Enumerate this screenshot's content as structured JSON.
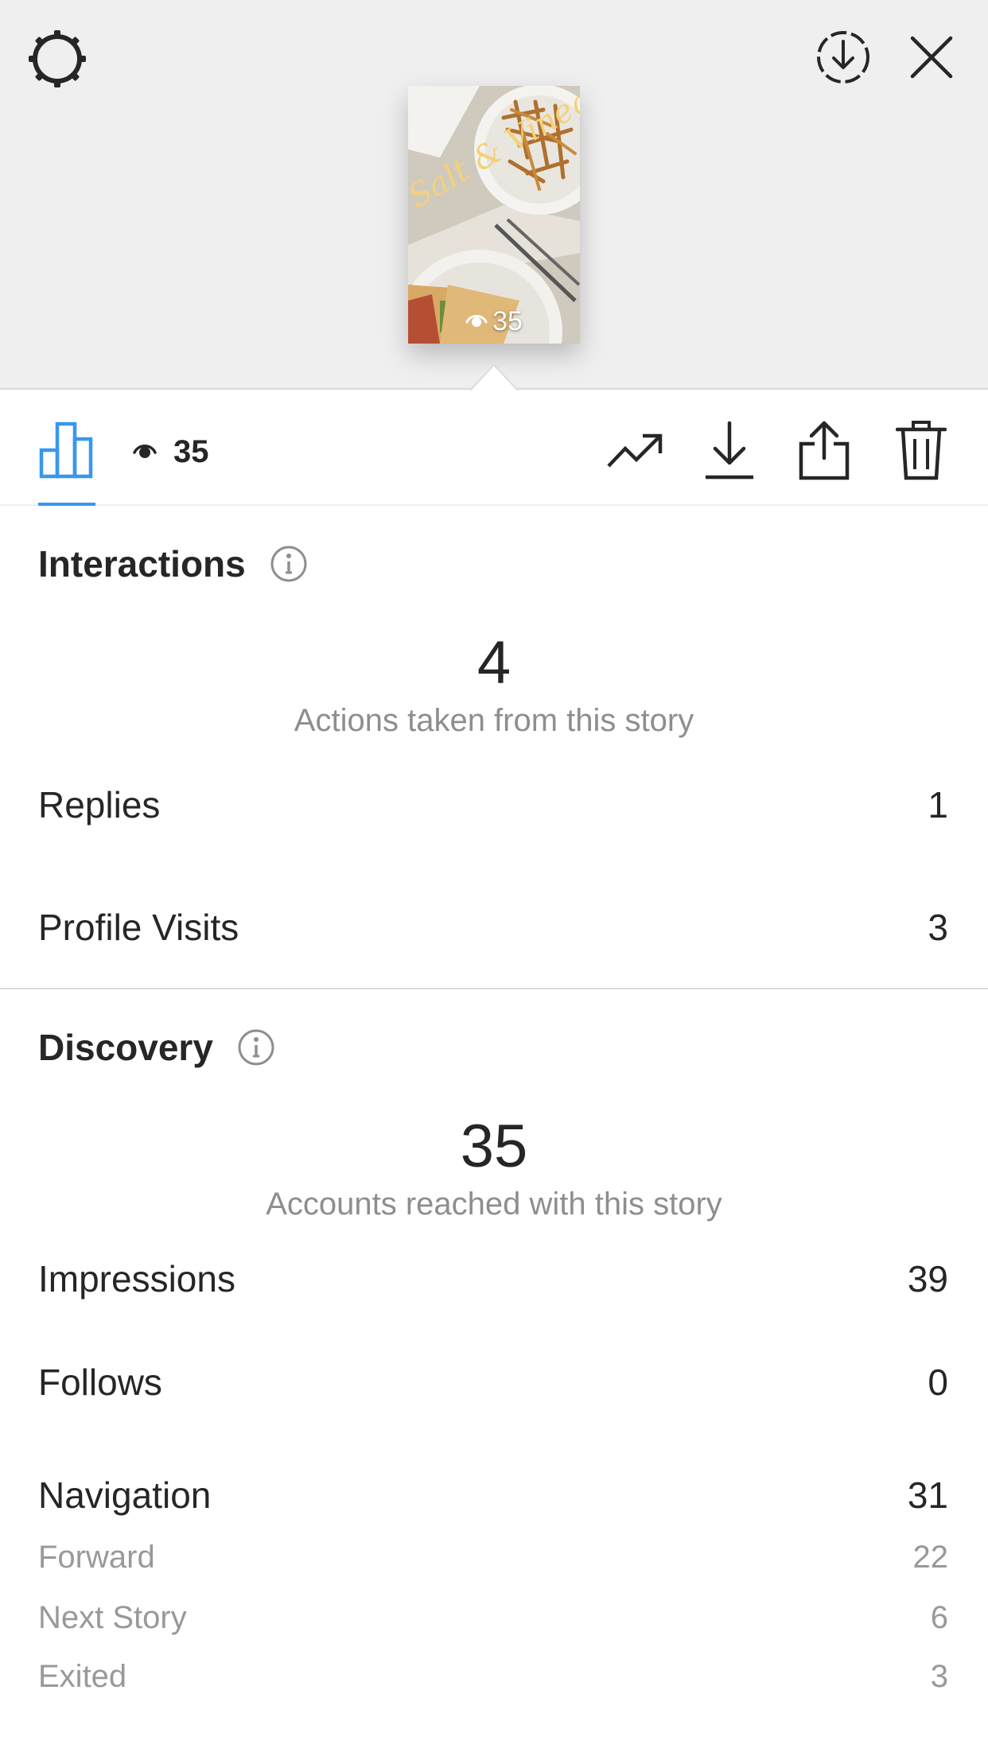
{
  "story": {
    "overlay_text": "Salt & Vinegar",
    "view_count": "35"
  },
  "toolbar": {
    "viewers_count": "35"
  },
  "interactions": {
    "title": "Interactions",
    "total": "4",
    "caption": "Actions taken from this story",
    "rows": [
      {
        "label": "Replies",
        "value": "1"
      },
      {
        "label": "Profile Visits",
        "value": "3"
      }
    ]
  },
  "discovery": {
    "title": "Discovery",
    "total": "35",
    "caption": "Accounts reached with this story",
    "rows": [
      {
        "label": "Impressions",
        "value": "39"
      },
      {
        "label": "Follows",
        "value": "0"
      },
      {
        "label": "Navigation",
        "value": "31"
      }
    ],
    "navigation_sub": [
      {
        "label": "Forward",
        "value": "22"
      },
      {
        "label": "Next Story",
        "value": "6"
      },
      {
        "label": "Exited",
        "value": "3"
      }
    ]
  },
  "colors": {
    "accent": "#3897f0",
    "top_background": "#efefef",
    "secondary_text": "#8e8e8e"
  },
  "icons": [
    "settings-icon",
    "download-circle-icon",
    "close-icon",
    "eye-icon",
    "bar-chart-icon",
    "trend-up-icon",
    "download-icon",
    "share-icon",
    "trash-icon",
    "info-icon"
  ]
}
